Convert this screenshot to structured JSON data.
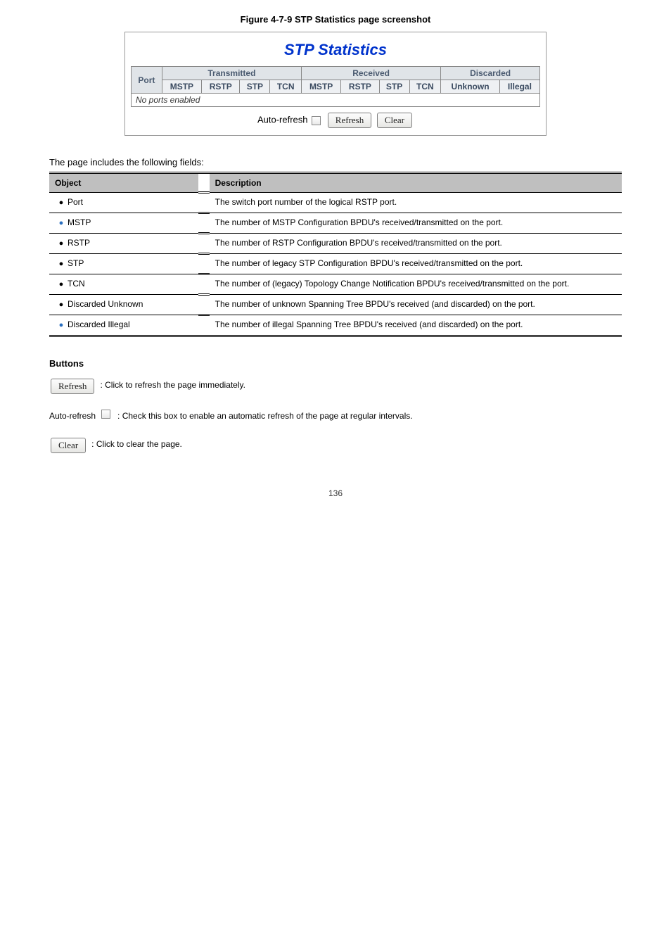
{
  "caption_top": "Figure 4-7-9 STP Statistics page screenshot",
  "figure": {
    "title": "STP Statistics",
    "groups": {
      "port": "Port",
      "tx": "Transmitted",
      "rx": "Received",
      "disc": "Discarded"
    },
    "sub": {
      "tx_mstp": "MSTP",
      "tx_rstp": "RSTP",
      "tx_stp": "STP",
      "tx_tcn": "TCN",
      "rx_mstp": "MSTP",
      "rx_rstp": "RSTP",
      "rx_stp": "STP",
      "rx_tcn": "TCN",
      "d_unknown": "Unknown",
      "d_illegal": "Illegal"
    },
    "no_ports": "No ports enabled",
    "auto_refresh": "Auto-refresh",
    "refresh_btn": "Refresh",
    "clear_btn": "Clear"
  },
  "desc_line": "The page includes the following fields:",
  "table": {
    "h1": "Object",
    "h2": "Description",
    "rows": [
      {
        "bullet_blue": false,
        "obj": "Port",
        "desc": "The switch port number of the logical RSTP port."
      },
      {
        "bullet_blue": true,
        "obj": "MSTP",
        "desc": "The number of MSTP Configuration BPDU's received/transmitted on the port."
      },
      {
        "bullet_blue": false,
        "obj": "RSTP",
        "desc": "The number of RSTP Configuration BPDU's received/transmitted on the port."
      },
      {
        "bullet_blue": false,
        "obj": "STP",
        "desc": "The number of legacy STP Configuration BPDU's received/transmitted on the port."
      },
      {
        "bullet_blue": false,
        "obj": "TCN",
        "desc": "The number of (legacy) Topology Change Notification BPDU's received/transmitted on the port."
      },
      {
        "bullet_blue": false,
        "obj": "Discarded Unknown",
        "desc": "The number of unknown Spanning Tree BPDU's received (and discarded) on the port."
      },
      {
        "bullet_blue": true,
        "obj": "Discarded Illegal",
        "desc": "The number of illegal Spanning Tree BPDU's received (and discarded) on the port."
      }
    ]
  },
  "buttons_heading": "Buttons",
  "btn_rows": [
    {
      "btn": "Refresh",
      "txt": ": Click to refresh the page immediately."
    },
    {
      "auto": true,
      "label": "Auto-refresh",
      "txt": ": Check this box to enable an automatic refresh of the page at regular intervals."
    },
    {
      "btn": "Clear",
      "txt": ": Click to clear the page."
    }
  ],
  "page_no": "136"
}
